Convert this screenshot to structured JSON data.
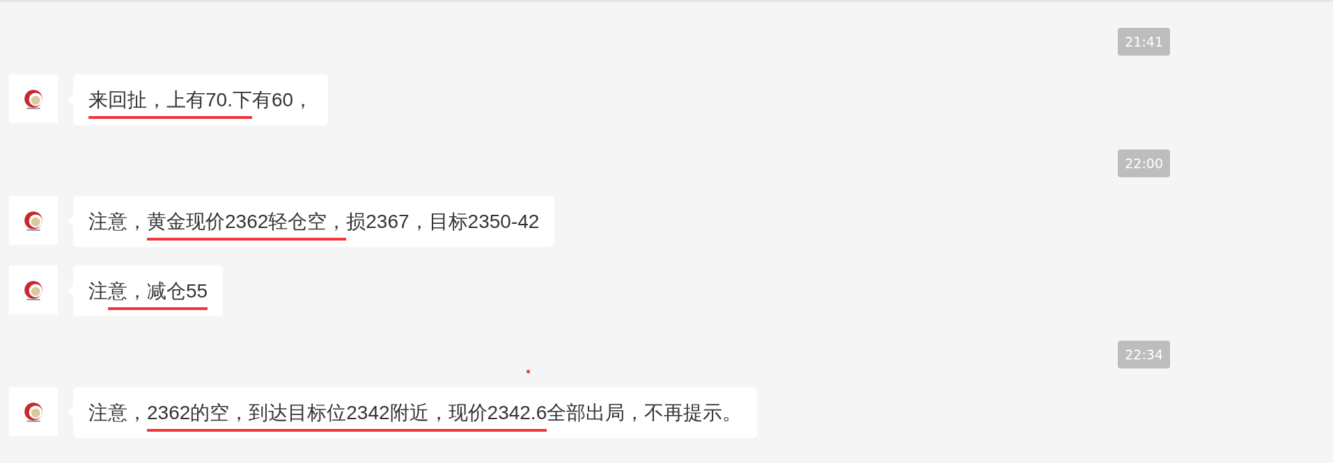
{
  "messages": [
    {
      "kind": "time",
      "text": "21:41"
    },
    {
      "kind": "message",
      "segments": [
        {
          "text": "来回扯，上有70.下",
          "underlined": true
        },
        {
          "text": "有60，",
          "underlined": false
        }
      ]
    },
    {
      "kind": "time",
      "text": "22:00"
    },
    {
      "kind": "message",
      "segments": [
        {
          "text": "注意，",
          "underlined": false
        },
        {
          "text": "黄金现价2362轻仓空，",
          "underlined": true
        },
        {
          "text": "损2367，目标2350-42",
          "underlined": false
        }
      ]
    },
    {
      "kind": "message",
      "segments": [
        {
          "text": "注",
          "underlined": false
        },
        {
          "text": "意，减仓55",
          "underlined": true
        }
      ]
    },
    {
      "kind": "time",
      "text": "22:34"
    },
    {
      "kind": "message",
      "segments": [
        {
          "text": "注意，",
          "underlined": false
        },
        {
          "text": "2362的空，到达目标位2342附近，现价2342.6",
          "underlined": true
        },
        {
          "text": "全部出局，不再提示。",
          "underlined": false
        }
      ]
    }
  ]
}
